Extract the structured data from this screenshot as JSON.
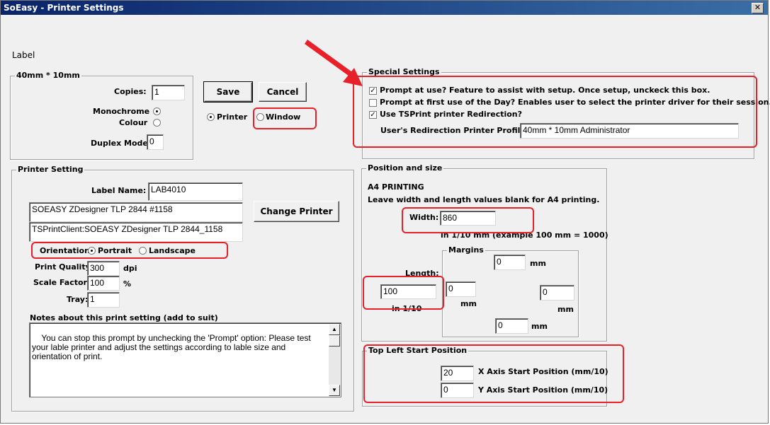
{
  "window": {
    "title": "SoEasy - Printer Settings",
    "close_glyph": "✕"
  },
  "label_section": {
    "heading": "Label",
    "group_title": "40mm * 10mm",
    "copies_label": "Copies:",
    "copies_value": "1",
    "monochrome_label": "Monochrome",
    "colour_label": "Colour",
    "duplex_label": "Duplex Mode",
    "duplex_value": "0"
  },
  "actions": {
    "save_label": "Save",
    "cancel_label": "Cancel",
    "printer_label": "Printer",
    "window_label": "Window"
  },
  "printer_setting": {
    "group_title": "Printer Setting",
    "label_name_label": "Label Name:",
    "label_name_value": "LAB4010",
    "printer_name": "SOEASY ZDesigner TLP 2844  #1158",
    "ts_printer_name": "TSPrintClient:SOEASY ZDesigner TLP 2844_1158",
    "change_printer_label": "Change Printer",
    "orientation_label": "Orientation:",
    "portrait_label": "Portrait",
    "landscape_label": "Landscape",
    "print_quality_label": "Print Quality:",
    "print_quality_value": "300",
    "dpi_label": "dpi",
    "scale_factor_label": "Scale Factor:",
    "scale_factor_value": "100",
    "percent_label": "%",
    "tray_label": "Tray:",
    "tray_value": "1",
    "notes_label": "Notes about this print setting (add to suit)",
    "notes_text": "You can stop this prompt by unchecking the 'Prompt' option: Please test your lable printer and adjust the settings according to lable size and orientation of print."
  },
  "special_settings": {
    "group_title": "Special Settings",
    "prompt_at_use_label": "Prompt at use? Feature to assist with setup. Once setup, unckeck this box.",
    "prompt_first_use_label": "Prompt at first use of the Day? Enables user to select the printer driver for their session.",
    "ts_redirection_label": "Use TSPrint printer Redirection?",
    "redirection_profile_label": "User's Redirection Printer Profile:",
    "redirection_profile_value": "40mm * 10mm Administrator"
  },
  "position_size": {
    "group_title": "Position and size",
    "a4_heading": "A4 PRINTING",
    "a4_note": "Leave width and length values blank for A4 printing.",
    "width_label": "Width:",
    "width_value": "860",
    "unit_note": "in 1/10 mm (example 100 mm = 1000)",
    "length_label": "Length:",
    "length_value": "100",
    "length_unit": "in 1/10",
    "margins_title": "Margins",
    "margin_top_value": "0",
    "margin_left_value": "0",
    "margin_right_value": "0",
    "margin_bottom_value": "0",
    "mm_label": "mm"
  },
  "top_left": {
    "group_title": "Top Left Start Position",
    "x_value": "20",
    "x_label": "X Axis Start Position (mm/10)",
    "y_value": "0",
    "y_label": "Y Axis Start Position (mm/10)"
  },
  "annotation": {
    "highlight_color": "#e8202a"
  }
}
